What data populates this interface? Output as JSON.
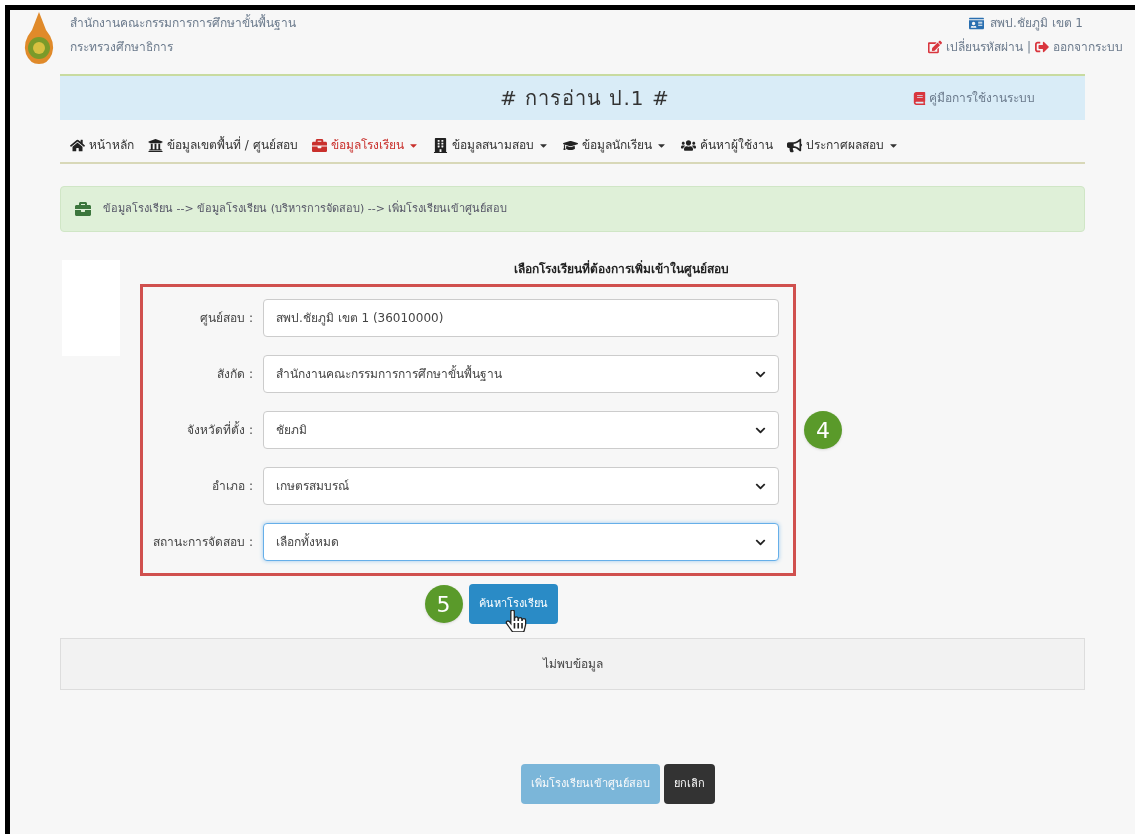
{
  "header": {
    "org_name": "สำนักงานคณะกรรมการการศึกษาขั้นพื้นฐาน",
    "ministry": "กระทรวงศึกษาธิการ",
    "user": "สพป.ชัยภูมิ เขต 1",
    "change_password": "เปลี่ยนรหัสผ่าน",
    "separator": "|",
    "logout": "ออกจากระบบ"
  },
  "title_bar": {
    "title": "# การอ่าน ป.1 #",
    "manual_link": "คู่มือการใช้งานระบบ"
  },
  "nav": [
    {
      "label": "หน้าหลัก",
      "selected": false,
      "dropdown": false
    },
    {
      "label": "ข้อมูลเขตพื้นที่ / ศูนย์สอบ",
      "selected": false,
      "dropdown": false
    },
    {
      "label": "ข้อมูลโรงเรียน",
      "selected": true,
      "dropdown": true
    },
    {
      "label": "ข้อมูลสนามสอบ",
      "selected": false,
      "dropdown": true
    },
    {
      "label": "ข้อมูลนักเรียน",
      "selected": false,
      "dropdown": true
    },
    {
      "label": "ค้นหาผู้ใช้งาน",
      "selected": false,
      "dropdown": false
    },
    {
      "label": "ประกาศผลสอบ",
      "selected": false,
      "dropdown": true
    }
  ],
  "breadcrumb": "ข้อมูลโรงเรียน --> ข้อมูลโรงเรียน (บริหารการจัดสอบ) --> เพิ่มโรงเรียนเข้าศูนย์สอบ",
  "form": {
    "heading": "เลือกโรงเรียนที่ต้องการเพิ่มเข้าในศูนย์สอบ",
    "step_badge": "4",
    "fields": [
      {
        "label": "ศูนย์สอบ :",
        "kind": "input",
        "value": "สพป.ชัยภูมิ เขต 1 (36010000)",
        "focused": false
      },
      {
        "label": "สังกัด :",
        "kind": "select",
        "value": "สำนักงานคณะกรรมการการศึกษาขั้นพื้นฐาน",
        "focused": false
      },
      {
        "label": "จังหวัดที่ตั้ง :",
        "kind": "select",
        "value": "ชัยภมิ",
        "focused": false
      },
      {
        "label": "อำเภอ :",
        "kind": "select",
        "value": "เกษตรสมบรณ์",
        "focused": false
      },
      {
        "label": "สถานะการจัดสอบ :",
        "kind": "select",
        "value": "เลือกทั้งหมด",
        "focused": true
      }
    ]
  },
  "search": {
    "step_badge": "5",
    "button": "ค้นหาโรงเรียน"
  },
  "result": "ไม่พบข้อมูล",
  "actions": [
    {
      "label": "เพิ่มโรงเรียนเข้าศูนย์สอบ",
      "kind": "primary",
      "disabled": true
    },
    {
      "label": "ยกเลิก",
      "kind": "dark",
      "disabled": false
    }
  ]
}
